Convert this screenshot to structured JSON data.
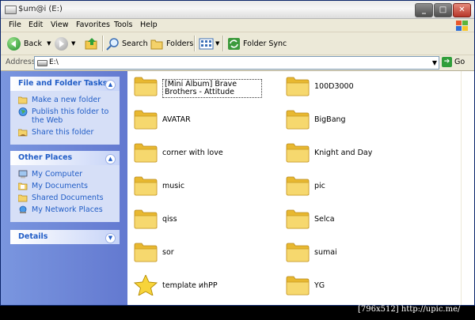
{
  "window": {
    "title": "$um@i (E:)"
  },
  "menu": [
    "File",
    "Edit",
    "View",
    "Favorites",
    "Tools",
    "Help"
  ],
  "toolbar": {
    "back": "Back",
    "search": "Search",
    "folders": "Folders",
    "folder_sync": "Folder Sync"
  },
  "address": {
    "label": "Address",
    "value": "E:\\",
    "go": "Go"
  },
  "tasks": {
    "title": "File and Folder Tasks",
    "items": [
      "Make a new folder",
      "Publish this folder to the Web",
      "Share this folder"
    ]
  },
  "other_places": {
    "title": "Other Places",
    "items": [
      "My Computer",
      "My Documents",
      "Shared Documents",
      "My Network Places"
    ]
  },
  "details": {
    "title": "Details"
  },
  "files": [
    {
      "name": "[Mini Album] Brave Brothers - Attitude",
      "icon": "folder",
      "selected": true
    },
    {
      "name": "100D3000",
      "icon": "folder"
    },
    {
      "name": "AVATAR",
      "icon": "folder"
    },
    {
      "name": "BigBang",
      "icon": "folder"
    },
    {
      "name": "corner with love",
      "icon": "folder"
    },
    {
      "name": "Knight and Day",
      "icon": "folder"
    },
    {
      "name": "music",
      "icon": "folder"
    },
    {
      "name": "pic",
      "icon": "folder"
    },
    {
      "name": "qiss",
      "icon": "folder"
    },
    {
      "name": "Selca",
      "icon": "folder"
    },
    {
      "name": "sor",
      "icon": "folder"
    },
    {
      "name": "sumai",
      "icon": "folder"
    },
    {
      "name": "template иhPP",
      "icon": "star"
    },
    {
      "name": "YG",
      "icon": "folder"
    }
  ],
  "watermark": "[796x512] http://upic.me/"
}
